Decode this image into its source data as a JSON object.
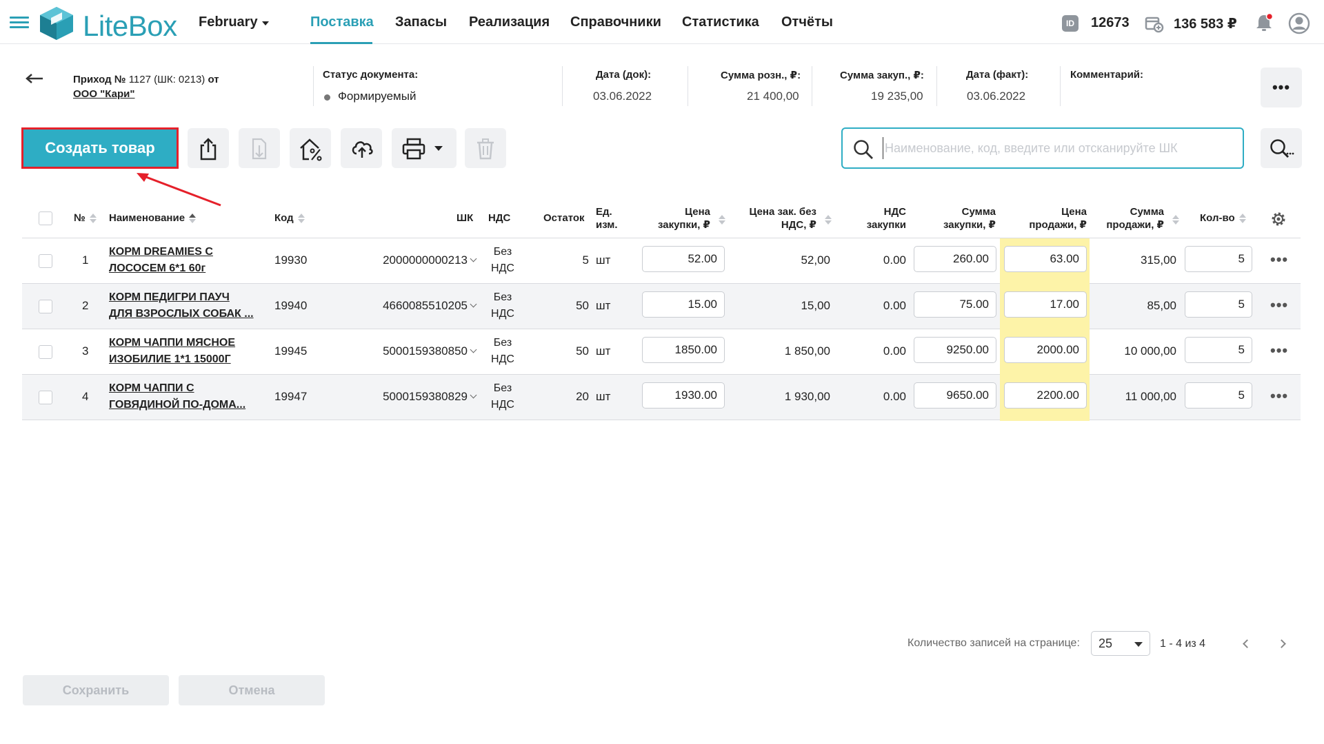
{
  "nav": {
    "logo_text": "LiteBox",
    "month": "February",
    "items": [
      {
        "label": "Поставка",
        "active": true
      },
      {
        "label": "Запасы"
      },
      {
        "label": "Реализация"
      },
      {
        "label": "Справочники"
      },
      {
        "label": "Статистика"
      },
      {
        "label": "Отчёты"
      }
    ],
    "id_badge": "ID",
    "account_id": "12673",
    "balance": "136 583 ₽"
  },
  "document": {
    "title_prefix": "Приход №",
    "title_number": "1127 (ШК: 0213)",
    "title_suffix": "от",
    "supplier": "ООО \"Кари\"",
    "status_label": "Статус документа:",
    "status_value": "Формируемый",
    "date_doc_label": "Дата (док):",
    "date_doc_value": "03.06.2022",
    "retail_sum_label": "Сумма розн., ₽:",
    "retail_sum_value": "21 400,00",
    "purchase_sum_label": "Сумма закуп., ₽:",
    "purchase_sum_value": "19 235,00",
    "date_fact_label": "Дата (факт):",
    "date_fact_value": "03.06.2022",
    "comment_label": "Комментарий:",
    "more_label": "•••"
  },
  "toolbar": {
    "create_label": "Создать товар",
    "search_placeholder": "Наименование, код, введите или отсканируйте ШК"
  },
  "table": {
    "headers": {
      "num": "№",
      "name": "Наименование",
      "code": "Код",
      "barcode": "ШК",
      "vat": "НДС",
      "stock": "Остаток",
      "unit_1": "Ед.",
      "unit_2": "изм.",
      "pprice_1": "Цена",
      "pprice_2": "закупки, ₽",
      "pprice_novat_1": "Цена зак. без",
      "pprice_novat_2": "НДС, ₽",
      "pvat_1": "НДС",
      "pvat_2": "закупки",
      "psum_1": "Сумма",
      "psum_2": "закупки, ₽",
      "sprice_1": "Цена",
      "sprice_2": "продажи, ₽",
      "ssum_1": "Сумма",
      "ssum_2": "продажи, ₽",
      "qty": "Кол-во"
    },
    "rows": [
      {
        "n": "1",
        "name_1": "КОРМ DREAMIES С",
        "name_2": "ЛОСОСЕМ 6*1 60г",
        "code": "19930",
        "barcode": "2000000000213",
        "vat_1": "Без",
        "vat_2": "НДС",
        "stock": "5",
        "unit": "шт",
        "pprice": "52.00",
        "pprice_novat": "52,00",
        "pvat": "0.00",
        "psum": "260.00",
        "sprice": "63.00",
        "ssum": "315,00",
        "qty": "5"
      },
      {
        "n": "2",
        "name_1": "КОРМ ПЕДИГРИ ПАУЧ",
        "name_2": "ДЛЯ ВЗРОСЛЫХ СОБАК ...",
        "code": "19940",
        "barcode": "4660085510205",
        "vat_1": "Без",
        "vat_2": "НДС",
        "stock": "50",
        "unit": "шт",
        "pprice": "15.00",
        "pprice_novat": "15,00",
        "pvat": "0.00",
        "psum": "75.00",
        "sprice": "17.00",
        "ssum": "85,00",
        "qty": "5"
      },
      {
        "n": "3",
        "name_1": "КОРМ ЧАППИ МЯСНОЕ",
        "name_2": "ИЗОБИЛИЕ 1*1 15000Г",
        "code": "19945",
        "barcode": "5000159380850",
        "vat_1": "Без",
        "vat_2": "НДС",
        "stock": "50",
        "unit": "шт",
        "pprice": "1850.00",
        "pprice_novat": "1 850,00",
        "pvat": "0.00",
        "psum": "9250.00",
        "sprice": "2000.00",
        "ssum": "10 000,00",
        "qty": "5"
      },
      {
        "n": "4",
        "name_1": "КОРМ ЧАППИ С",
        "name_2": "ГОВЯДИНОЙ ПО-ДОМА...",
        "code": "19947",
        "barcode": "5000159380829",
        "vat_1": "Без",
        "vat_2": "НДС",
        "stock": "20",
        "unit": "шт",
        "pprice": "1930.00",
        "pprice_novat": "1 930,00",
        "pvat": "0.00",
        "psum": "9650.00",
        "sprice": "2200.00",
        "ssum": "11 000,00",
        "qty": "5"
      }
    ]
  },
  "pagination": {
    "per_page_label": "Количество записей на странице:",
    "per_page_value": "25",
    "range": "1 - 4 из 4"
  },
  "footer": {
    "save_label": "Сохранить",
    "cancel_label": "Отмена"
  },
  "colors": {
    "accent": "#2eadc4",
    "highlight_border": "#e5202a",
    "price_column": "#fdf3a8"
  }
}
